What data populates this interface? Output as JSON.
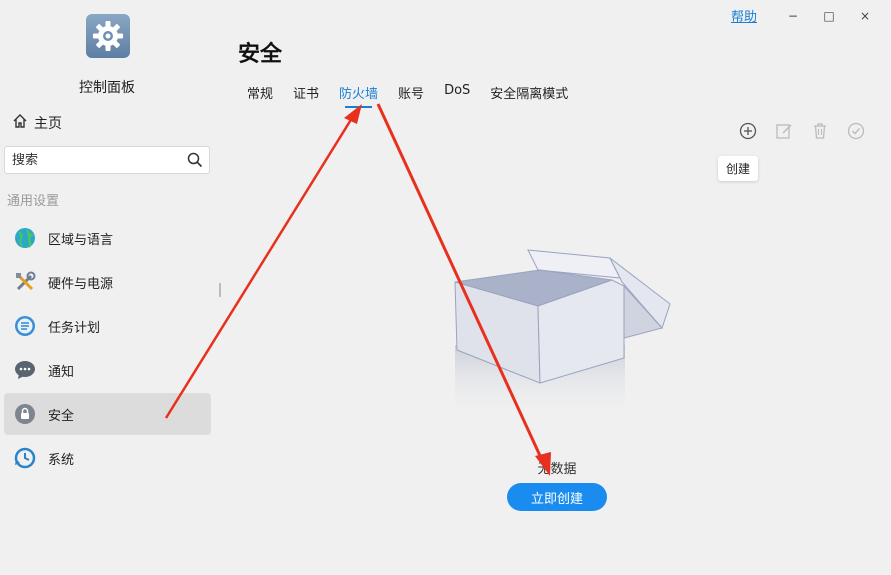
{
  "window": {
    "help_link": "帮助",
    "minimize": "−",
    "maximize": "□",
    "close": "×"
  },
  "sidebar": {
    "app_title": "控制面板",
    "home_label": "主页",
    "search_placeholder": "搜索",
    "section_label": "通用设置",
    "items": [
      {
        "label": "区域与语言",
        "icon": "globe-icon"
      },
      {
        "label": "硬件与电源",
        "icon": "tools-icon"
      },
      {
        "label": "任务计划",
        "icon": "task-list-icon"
      },
      {
        "label": "通知",
        "icon": "chat-bubble-icon"
      },
      {
        "label": "安全",
        "icon": "lock-icon",
        "active": true
      },
      {
        "label": "系统",
        "icon": "system-clock-icon"
      }
    ]
  },
  "main": {
    "title": "安全",
    "tabs": [
      {
        "label": "常规"
      },
      {
        "label": "证书"
      },
      {
        "label": "防火墙",
        "active": true
      },
      {
        "label": "账号"
      },
      {
        "label": "DoS"
      },
      {
        "label": "安全隔离模式"
      }
    ],
    "toolbar": {
      "icons": [
        "add-icon",
        "edit-icon",
        "delete-icon",
        "check-icon"
      ],
      "tooltip": "创建"
    },
    "empty_state": {
      "text": "无数据",
      "button_label": "立即创建"
    }
  },
  "colors": {
    "accent": "#1a7fd4",
    "button": "#1a8cf0",
    "annotation_arrow": "#e8301e"
  }
}
